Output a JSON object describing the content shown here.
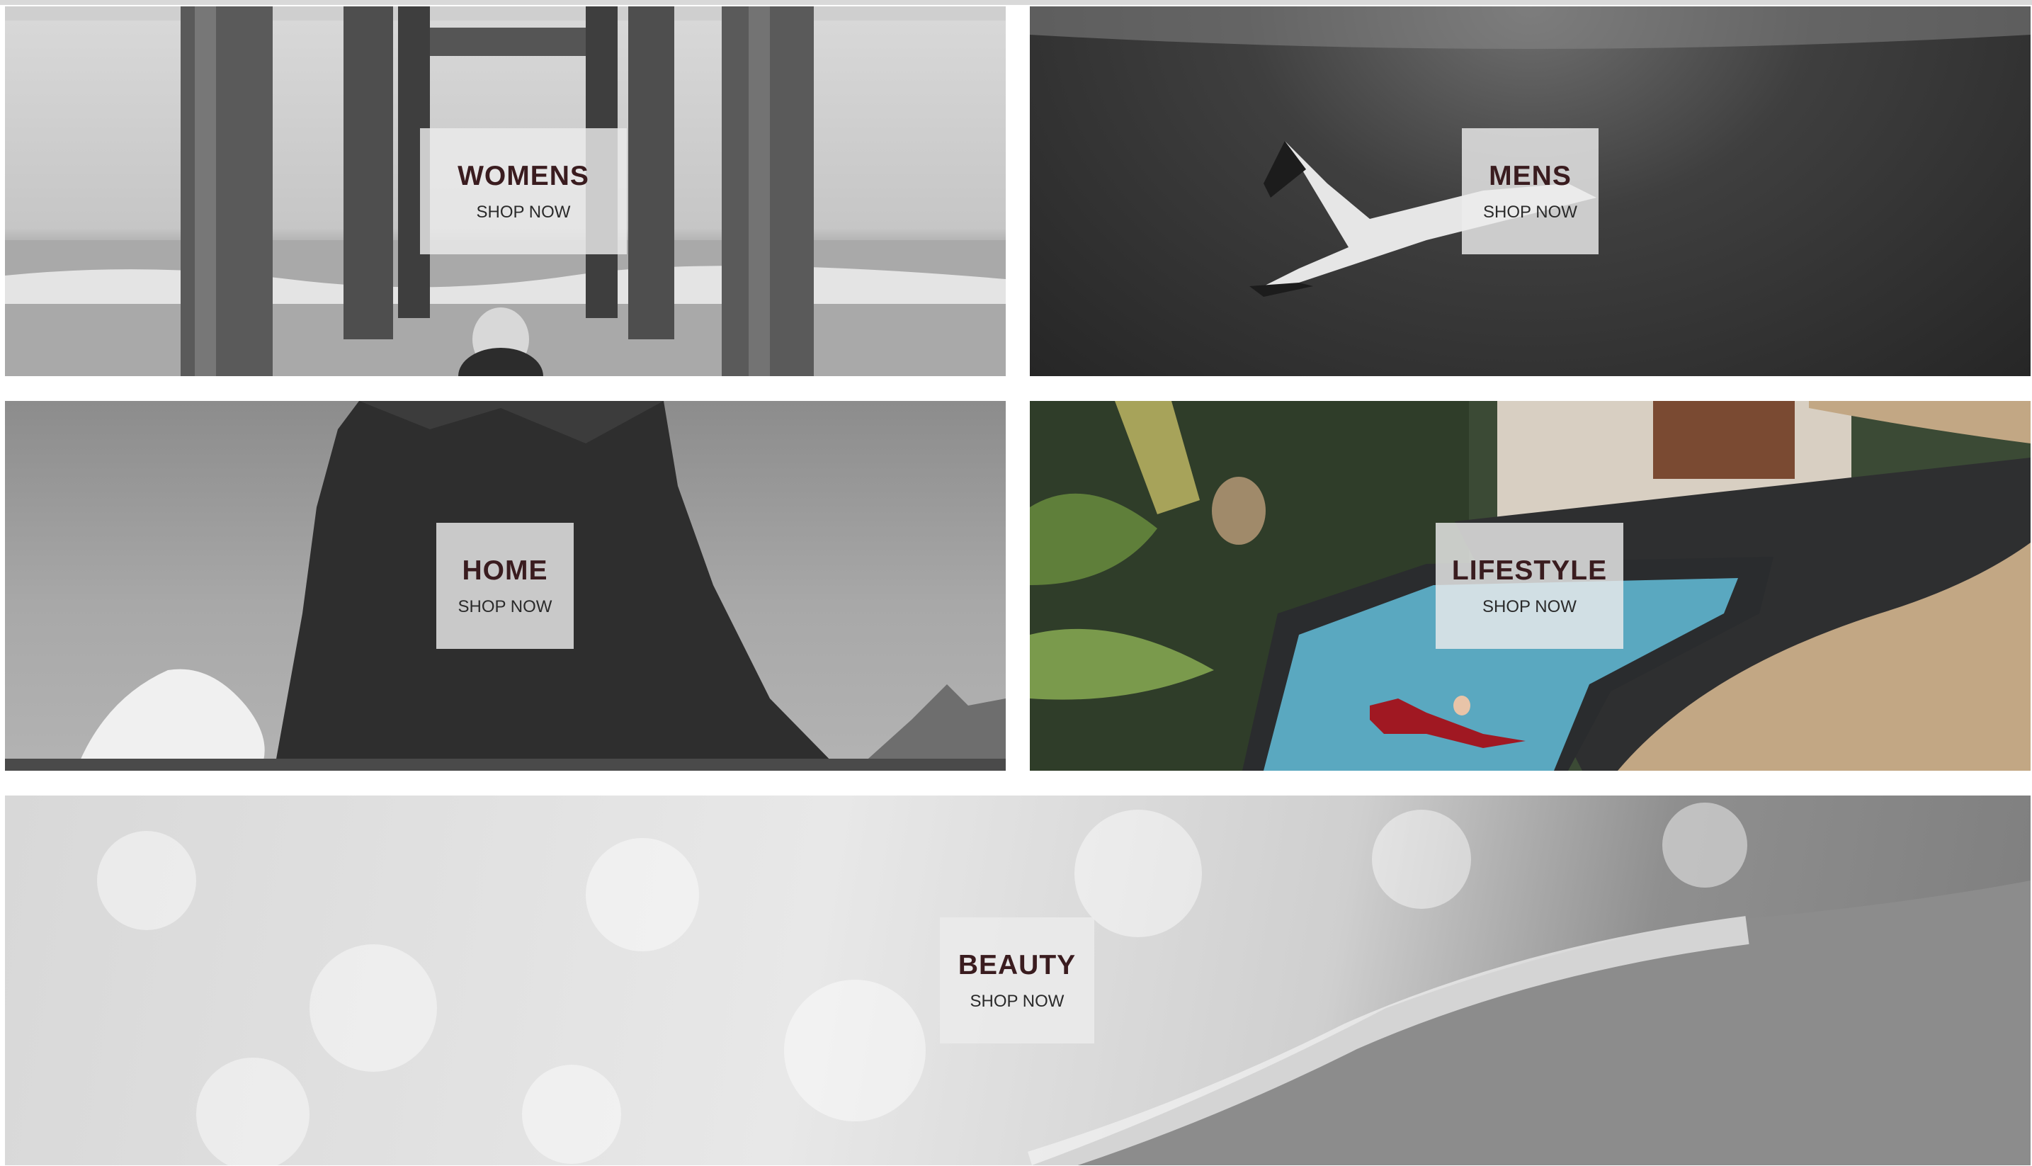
{
  "categories": [
    {
      "id": "womens",
      "title": "WOMENS",
      "cta": "SHOP NOW"
    },
    {
      "id": "mens",
      "title": "MENS",
      "cta": "SHOP NOW"
    },
    {
      "id": "home",
      "title": "HOME",
      "cta": "SHOP NOW"
    },
    {
      "id": "lifestyle",
      "title": "LIFESTYLE",
      "cta": "SHOP NOW"
    },
    {
      "id": "beauty",
      "title": "BEAUTY",
      "cta": "SHOP NOW"
    }
  ],
  "colors": {
    "title_text": "#3a1c1f",
    "cta_text": "#2a2a2a",
    "label_box_bg": "rgba(235,235,235,0.82)",
    "pool_water": "#5aa8c0",
    "swimsuit": "#a01822"
  },
  "images": {
    "womens": "grayscale-pier-ocean-swimmer",
    "mens": "grayscale-underwater-freediver",
    "home": "grayscale-sea-rock-wave",
    "lifestyle": "color-tropical-pool-swimmer",
    "beauty": "grayscale-ocean-wave-foam"
  }
}
